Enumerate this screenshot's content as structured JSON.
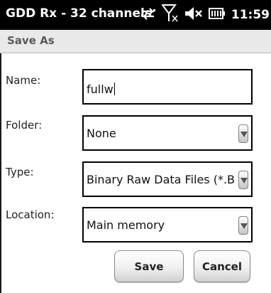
{
  "status_bar": {
    "app_title": "GDD Rx - 32 channels",
    "time": "11:59",
    "icons": [
      "sync-arrows-icon",
      "no-signal-icon",
      "volume-muted-icon",
      "battery-icon"
    ]
  },
  "dialog": {
    "title": "Save As"
  },
  "form": {
    "name": {
      "label": "Name:",
      "value": "fullw"
    },
    "folder": {
      "label": "Folder:",
      "value": "None"
    },
    "type": {
      "label": "Type:",
      "value": "Binary Raw Data Files (*.B"
    },
    "location": {
      "label": "Location:",
      "value": "Main memory"
    }
  },
  "buttons": {
    "save": "Save",
    "cancel": "Cancel"
  }
}
